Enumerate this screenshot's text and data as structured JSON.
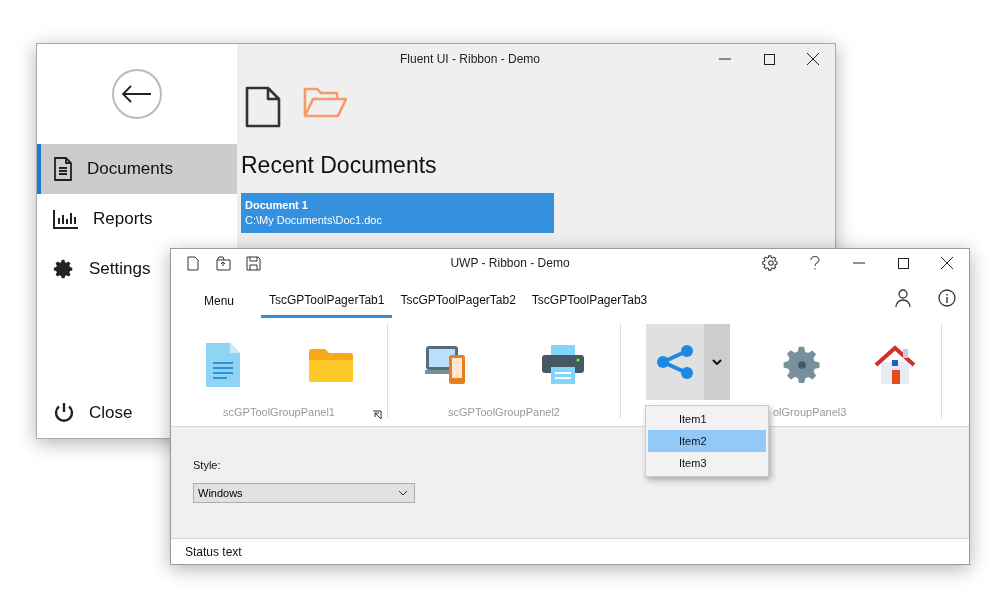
{
  "back_window": {
    "title": "Fluent UI - Ribbon - Demo",
    "sidebar": {
      "items": [
        {
          "label": "Documents",
          "selected": true
        },
        {
          "label": "Reports",
          "selected": false
        },
        {
          "label": "Settings",
          "selected": false
        }
      ],
      "close_label": "Close"
    },
    "recent_title": "Recent Documents",
    "documents": [
      {
        "name": "Document 1",
        "path": "C:\\My Documents\\Doc1.doc",
        "selected": true
      }
    ]
  },
  "front_window": {
    "title": "UWP - Ribbon - Demo",
    "menu_button": "Menu",
    "tabs": [
      {
        "label": "TscGPToolPagerTab1",
        "selected": true
      },
      {
        "label": "TscGPToolPagerTab2",
        "selected": false
      },
      {
        "label": "TscGPToolPagerTab3",
        "selected": false
      }
    ],
    "panels": [
      {
        "label": "scGPToolGroupPanel1"
      },
      {
        "label": "scGPToolGroupPanel2"
      },
      {
        "label": "olGroupPanel3"
      }
    ],
    "split_menu": {
      "items": [
        {
          "label": "Item1",
          "selected": false
        },
        {
          "label": "Item2",
          "selected": true
        },
        {
          "label": "Item3",
          "selected": false
        }
      ]
    },
    "style": {
      "label": "Style:",
      "value": "Windows"
    },
    "status_bar": "Status text"
  }
}
